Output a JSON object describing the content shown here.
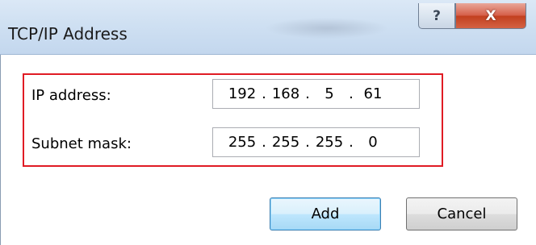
{
  "window": {
    "title": "TCP/IP Address",
    "help_glyph": "?",
    "close_glyph": "X"
  },
  "form": {
    "ip_label": "IP address:",
    "ip_octets": [
      "192",
      "168",
      "5",
      "61"
    ],
    "mask_label": "Subnet mask:",
    "mask_octets": [
      "255",
      "255",
      "255",
      "0"
    ],
    "separator": "."
  },
  "buttons": {
    "add": "Add",
    "cancel": "Cancel"
  },
  "colors": {
    "highlight_border": "#e01b24",
    "close_button": "#c2401f"
  },
  "icons": {
    "help": "help-icon",
    "close": "close-icon"
  }
}
